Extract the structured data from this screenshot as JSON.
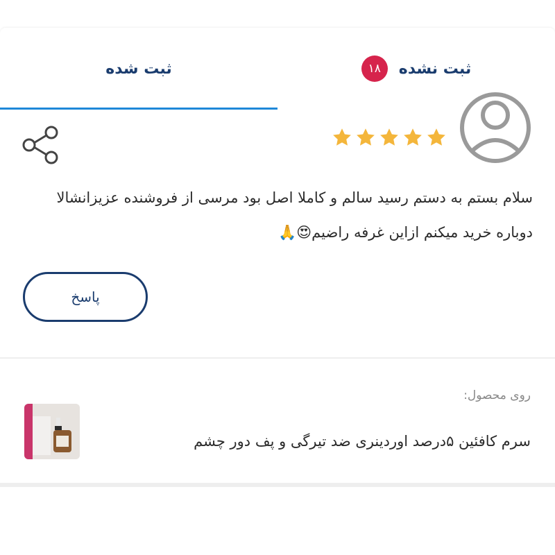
{
  "tabs": {
    "registered_label": "ثبت شده",
    "unregistered_label": "ثبت نشده",
    "unregistered_count": "۱۸",
    "active": "registered"
  },
  "review": {
    "rating": 5,
    "max_rating": 5,
    "comment_line1": "سلام بستم به دستم رسید سالم و کاملا اصل بود مرسی از فروشنده عزیزانشالا",
    "comment_line2": "دوباره خرید میکنم ازاین غرفه راضیم😍🙏",
    "reply_label": "پاسخ",
    "icons": [
      "user-avatar-icon",
      "star-icon",
      "share-icon"
    ]
  },
  "product": {
    "label": "روی محصول:",
    "name": "سرم کافئین ۵درصد اوردینری ضد تیرگی و پف دور چشم"
  },
  "colors": {
    "brand_dark": "#1a3c6e",
    "tab_indicator": "#1e88d8",
    "badge": "#d6244c",
    "star": "#f4b63b"
  }
}
